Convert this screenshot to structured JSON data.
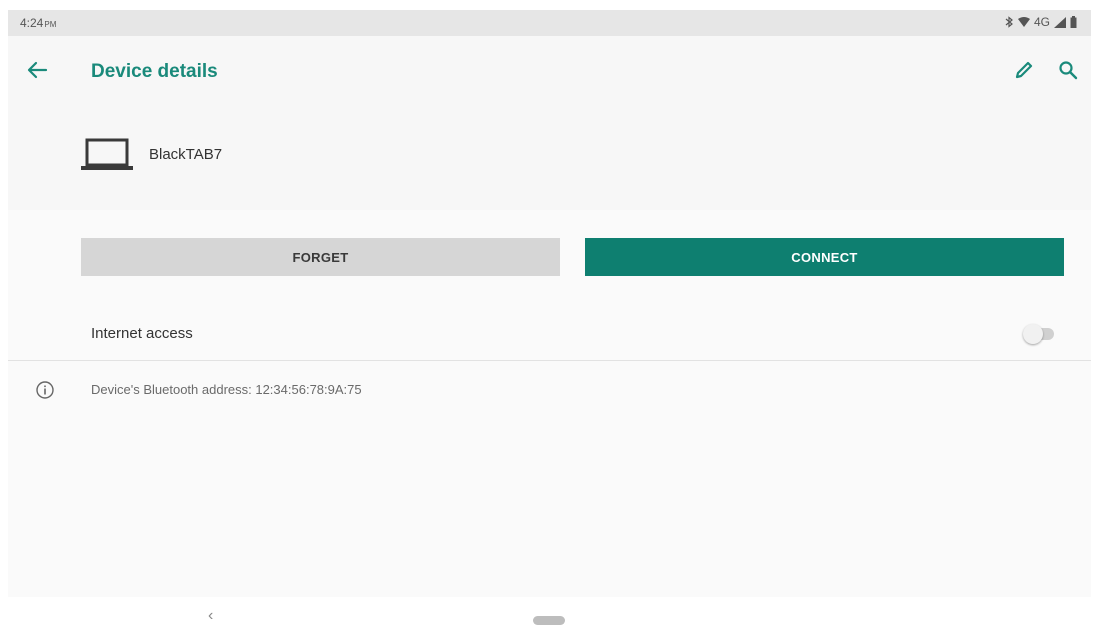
{
  "status_bar": {
    "time": "4:24",
    "ampm": "PM",
    "network": "4G",
    "icons": [
      "bluetooth-icon",
      "wifi-icon",
      "signal-icon",
      "battery-icon"
    ]
  },
  "app_bar": {
    "title": "Device details",
    "icons": [
      "back-arrow-icon",
      "edit-icon",
      "search-icon"
    ]
  },
  "device": {
    "name": "BlackTAB7",
    "icon": "laptop-icon"
  },
  "actions": {
    "forget_label": "FORGET",
    "connect_label": "CONNECT"
  },
  "internet_access": {
    "label": "Internet access",
    "enabled": false
  },
  "info": {
    "icon": "info-icon",
    "text": "Device's Bluetooth address: 12:34:56:78:9A:75"
  },
  "nav": {
    "back_glyph": "‹"
  },
  "colors": {
    "accent": "#1a8a7b",
    "connect_bg": "#0e7f70",
    "forget_bg": "#d6d6d6",
    "background": "#f7f7f7"
  }
}
